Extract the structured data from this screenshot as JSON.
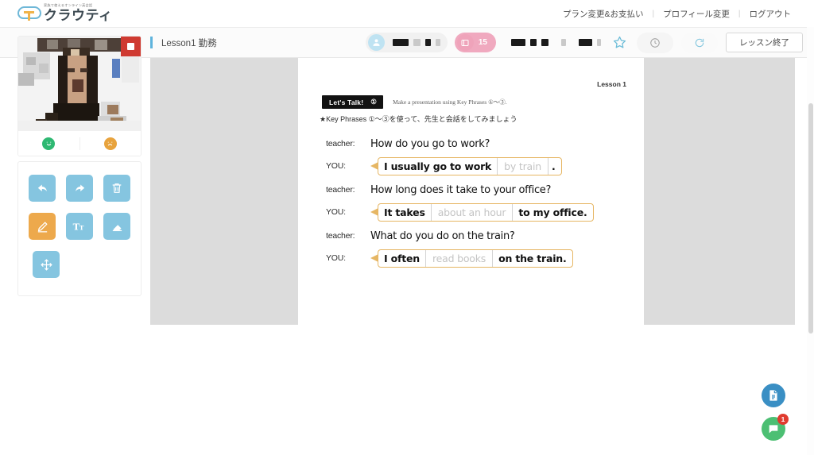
{
  "header": {
    "logo_tagline": "家族で使えるオンライン英会話",
    "logo_name": "クラウティ",
    "nav": [
      {
        "label": "プラン変更&お支払い"
      },
      {
        "label": "プロフィール変更"
      },
      {
        "label": "ログアウト"
      }
    ],
    "nav_separator": "|"
  },
  "toolbar": {
    "lesson_title": "Lesson1 勤務",
    "teacher_icon": "teacher-avatar-icon",
    "student_icon": "student-avatar-icon",
    "student_count": "15",
    "star_icon": "★",
    "timer_icon": "clock-icon",
    "refresh_icon": "refresh-icon",
    "end_lesson_label": "レッスン終了"
  },
  "left_panel": {
    "record_button": "record-stop-button",
    "reactions": [
      {
        "name": "happy-reaction",
        "glyph": "☺",
        "color": "#2eb872"
      },
      {
        "name": "sad-reaction",
        "glyph": "☹",
        "color": "#e8a33d"
      }
    ],
    "tools": [
      {
        "name": "undo-tool",
        "glyph": "↰",
        "active": false
      },
      {
        "name": "redo-tool",
        "glyph": "↱",
        "active": false
      },
      {
        "name": "trash-tool",
        "glyph": "🗑",
        "active": false
      },
      {
        "name": "pen-tool",
        "glyph": "✎",
        "active": true
      },
      {
        "name": "text-tool",
        "glyph": "Tt",
        "active": false
      },
      {
        "name": "eraser-tool",
        "glyph": "◣",
        "active": false
      },
      {
        "name": "move-tool",
        "glyph": "✥",
        "active": false
      }
    ]
  },
  "worksheet": {
    "lesson_number": "Lesson 1",
    "lets_talk_label": "Let's Talk!",
    "lets_talk_number": "①",
    "instruction_en": "Make a presentation using Key Phrases ①〜③.",
    "instruction_ja": "★Key Phrases ①〜③を使って、先生と会話をしてみましょう",
    "dialogue": [
      {
        "teacher_label": "teacher:",
        "question": "How do you go to work?",
        "you_label": "YOU:",
        "answer_prefix": "I usually go to work",
        "answer_blank": "by train",
        "answer_suffix": "."
      },
      {
        "teacher_label": "teacher:",
        "question": "How long does it take to your office?",
        "you_label": "YOU:",
        "answer_prefix": "It takes",
        "answer_blank": "about an hour",
        "answer_suffix": "to my office."
      },
      {
        "teacher_label": "teacher:",
        "question": "What do you do on the train?",
        "you_label": "YOU:",
        "answer_prefix": "I often",
        "answer_blank": "read books",
        "answer_suffix": "on the train."
      }
    ]
  },
  "floating": {
    "document_icon": "document-icon",
    "chat_icon": "chat-icon",
    "chat_badge": "1"
  }
}
